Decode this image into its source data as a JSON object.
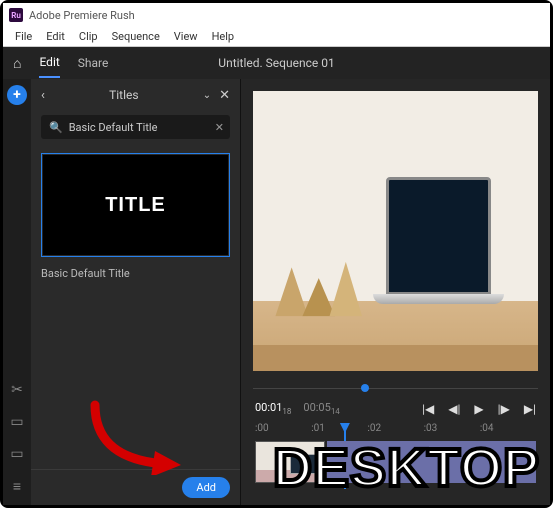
{
  "app": {
    "icon_text": "Ru",
    "title": "Adobe Premiere Rush"
  },
  "menu": [
    "File",
    "Edit",
    "Clip",
    "Sequence",
    "View",
    "Help"
  ],
  "topbar": {
    "tabs": {
      "edit": "Edit",
      "share": "Share"
    },
    "sequence": "Untitled. Sequence 01"
  },
  "panel": {
    "title": "Titles",
    "search_value": "Basic Default Title",
    "thumb_text": "TITLE",
    "thumb_label": "Basic Default Title",
    "add_label": "Add"
  },
  "playback": {
    "time_current": "00:01",
    "time_current_frames": "18",
    "time_total": "00:05",
    "time_total_frames": "14",
    "ruler": [
      ":00",
      ":01",
      ":02",
      ":03",
      ":04"
    ]
  },
  "overlay": "DESKTOP"
}
